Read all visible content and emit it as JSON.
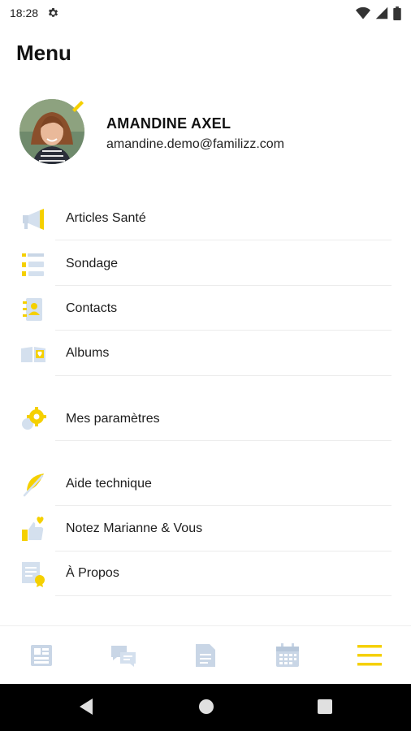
{
  "status_bar": {
    "time": "18:28"
  },
  "header": {
    "title": "Menu"
  },
  "profile": {
    "name": "AMANDINE AXEL",
    "email": "amandine.demo@familizz.com"
  },
  "menu": {
    "items": [
      {
        "label": "Articles Santé",
        "icon": "megaphone-icon"
      },
      {
        "label": "Sondage",
        "icon": "poll-icon"
      },
      {
        "label": "Contacts",
        "icon": "contacts-book-icon"
      },
      {
        "label": "Albums",
        "icon": "photo-album-icon"
      },
      {
        "label": "Mes paramètres",
        "icon": "settings-gear-icon"
      },
      {
        "label": "Aide technique",
        "icon": "feather-icon"
      },
      {
        "label": "Notez Marianne & Vous",
        "icon": "thumbs-up-heart-icon"
      },
      {
        "label": "À Propos",
        "icon": "certificate-icon"
      }
    ]
  },
  "bottom_nav": {
    "items": [
      "news-icon",
      "chat-icon",
      "document-icon",
      "calendar-icon",
      "hamburger-menu-icon"
    ],
    "active": "hamburger-menu-icon"
  },
  "colors": {
    "accent": "#f5d000",
    "icon_muted": "#c9d6e6",
    "text": "#1d1d1d"
  }
}
